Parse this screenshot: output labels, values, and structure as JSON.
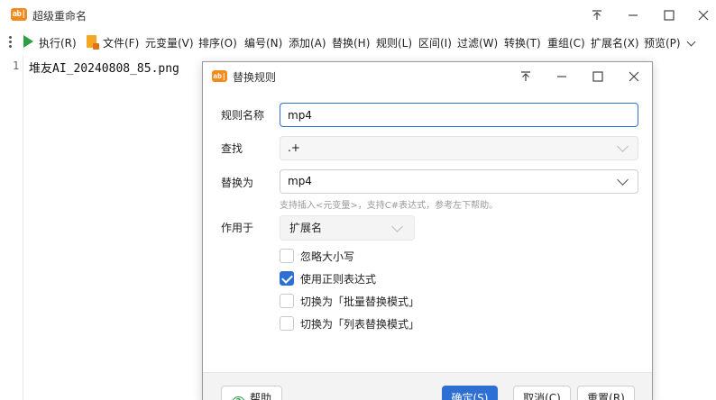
{
  "window": {
    "title": "超级重命名",
    "icon_text": "ab|"
  },
  "toolbar": {
    "items": [
      {
        "label": "执行(R)"
      },
      {
        "label": "文件(F)"
      },
      {
        "label": "元变量(V)"
      },
      {
        "label": "排序(O)"
      },
      {
        "label": "编号(N)"
      },
      {
        "label": "添加(A)"
      },
      {
        "label": "替换(H)"
      },
      {
        "label": "规则(L)"
      },
      {
        "label": "区间(I)"
      },
      {
        "label": "过滤(W)"
      },
      {
        "label": "转换(T)"
      },
      {
        "label": "重组(C)"
      },
      {
        "label": "扩展名(X)"
      },
      {
        "label": "预览(P)"
      }
    ]
  },
  "editor": {
    "line_number": "1",
    "line_text": "堆友AI_20240808_85.png"
  },
  "dialog": {
    "title": "替换规则",
    "rule_name_label": "规则名称",
    "rule_name_value": "mp4",
    "find_label": "查找",
    "find_value": ".+",
    "replace_label": "替换为",
    "replace_value": "mp4",
    "hint": "支持插入<元变量>，支持C#表达式，参考左下帮助。",
    "apply_label": "作用于",
    "apply_value": "扩展名",
    "options": [
      {
        "label": "忽略大小写",
        "checked": false
      },
      {
        "label": "使用正则表达式",
        "checked": true
      },
      {
        "label": "切换为「批量替换模式」",
        "checked": false
      },
      {
        "label": "切换为「列表替换模式」",
        "checked": false
      }
    ],
    "buttons": {
      "help": "帮助",
      "ok": "确定(S)",
      "cancel": "取消(C)",
      "reset": "重置(R)"
    }
  },
  "colors": {
    "accent": "#2d6fd2",
    "play_green": "#2ea043",
    "app_orange": "#f28a1e"
  }
}
